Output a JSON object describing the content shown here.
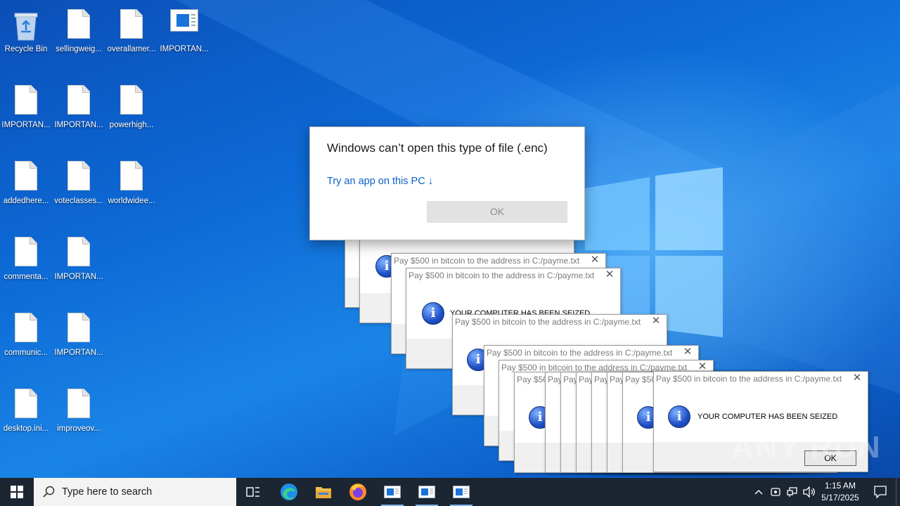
{
  "desktop_icons": [
    {
      "label": "Recycle Bin",
      "type": "recycle-bin"
    },
    {
      "label": "sellingweig...",
      "type": "file"
    },
    {
      "label": "overallamer...",
      "type": "file"
    },
    {
      "label": "IMPORTAN...",
      "type": "app"
    },
    {
      "label": "IMPORTAN...",
      "type": "file"
    },
    {
      "label": "IMPORTAN...",
      "type": "file"
    },
    {
      "label": "powerhigh...",
      "type": "file"
    },
    {
      "label": "addedhere...",
      "type": "file"
    },
    {
      "label": "voteclasses...",
      "type": "file"
    },
    {
      "label": "worldwidee...",
      "type": "file"
    },
    {
      "label": "commenta...",
      "type": "file"
    },
    {
      "label": "IMPORTAN...",
      "type": "file"
    },
    {
      "label": "communic...",
      "type": "file"
    },
    {
      "label": "IMPORTAN...",
      "type": "file"
    },
    {
      "label": "desktop.ini...",
      "type": "file"
    },
    {
      "label": "improveov...",
      "type": "file"
    }
  ],
  "open_with_dialog": {
    "title": "Windows can’t open this type of file (.enc)",
    "link": "Try an app on this PC ↓",
    "ok_label": "OK"
  },
  "ransom_box": {
    "caption": "Pay $500 in bitcoin to the address in C:/payme.txt",
    "message": "YOUR COMPUTER HAS BEEN SEIZED",
    "info_glyph": "i",
    "ok_label": "OK",
    "close_glyph": "✕",
    "partial_captions": [
      "Pay $50",
      "Pay",
      "Pay",
      "Pay",
      "Pay",
      "Pay",
      "Pay $50"
    ]
  },
  "watermark": "ANY RUN",
  "taskbar": {
    "search_placeholder": "Type here to search",
    "time": "1:15 AM",
    "date": "5/17/2025",
    "tray_chevron": "^",
    "pinned": [
      "task-view",
      "edge",
      "file-explorer",
      "firefox",
      "ransom-app",
      "ransom-app",
      "ransom-app"
    ]
  },
  "colors": {
    "accent": "#0a62c4",
    "taskbar": "#1c2532",
    "wallpaper": "#0d6ad6"
  }
}
